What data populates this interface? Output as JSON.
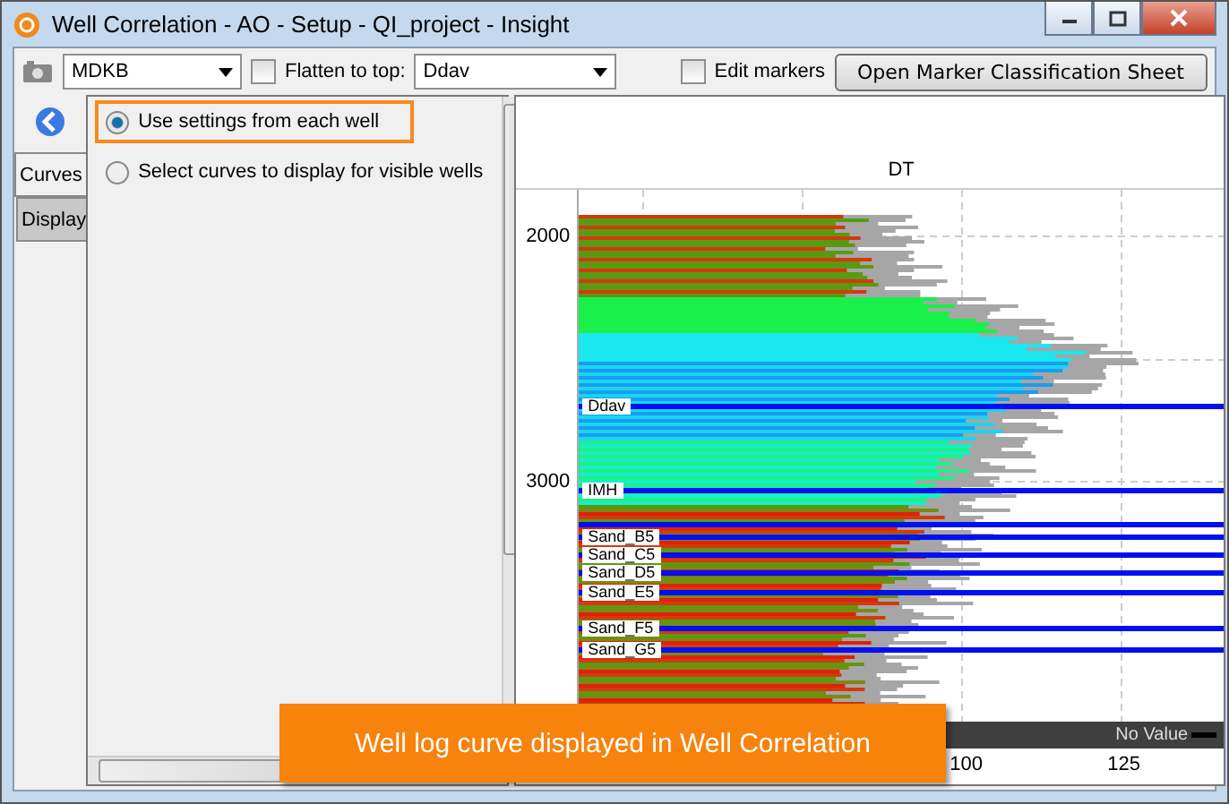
{
  "window": {
    "title": "Well Correlation - AO - Setup - QI_project - Insight"
  },
  "toolbar": {
    "depth_reference": "MDKB",
    "flatten": {
      "label": "Flatten to top:",
      "checked": false
    },
    "flatten_top": "Ddav",
    "edit_markers": {
      "label": "Edit markers",
      "checked": false
    },
    "sheet_button": "Open Marker Classification Sheet"
  },
  "side_tabs": [
    {
      "label": "Curves",
      "selected": true
    },
    {
      "label": "Display",
      "selected": false
    }
  ],
  "options": [
    {
      "label": "Use settings from each well",
      "selected": true,
      "highlighted": true
    },
    {
      "label": "Select curves to display for visible wells",
      "selected": false,
      "highlighted": false
    }
  ],
  "plot": {
    "curve": "DT",
    "depth_ticks": [
      "2000",
      "3000"
    ],
    "markers": [
      {
        "label": "Ddav"
      },
      {
        "label": "IMH"
      },
      {
        "label": "Sand_B5"
      },
      {
        "label": "Sand_C5"
      },
      {
        "label": "Sand_D5"
      },
      {
        "label": "Sand_E5"
      },
      {
        "label": "Sand_F5"
      },
      {
        "label": "Sand_G5"
      }
    ],
    "legend": "No Value",
    "scale_ticks": [
      "100",
      "125"
    ]
  },
  "callout": "Well log curve displayed in Well Correlation"
}
